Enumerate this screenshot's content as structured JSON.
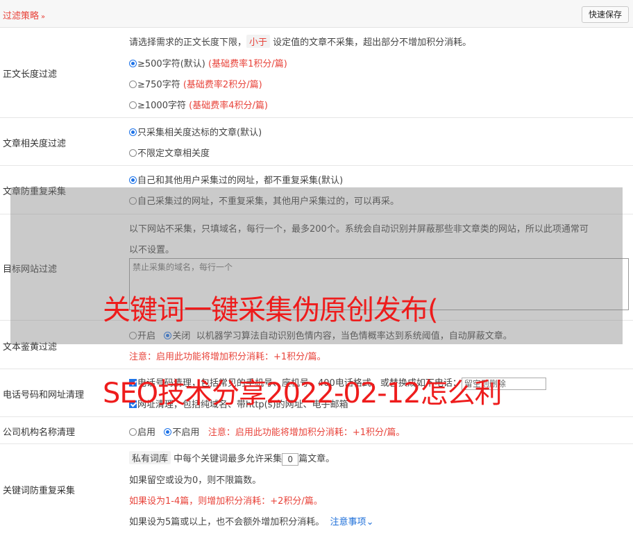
{
  "header": {
    "filter_title": "过滤策略",
    "chevron": "»",
    "save_button": "快速保存"
  },
  "length_filter": {
    "label": "正文长度过滤",
    "intro_pre": "请选择需求的正文长度下限，",
    "intro_tag": "小于",
    "intro_post": " 设定值的文章不采集，超出部分不增加积分消耗。",
    "options": [
      {
        "text": "≥500字符(默认)",
        "rate": "(基础费率1积分/篇)",
        "checked": true
      },
      {
        "text": "≥750字符",
        "rate": "(基础费率2积分/篇)",
        "checked": false
      },
      {
        "text": "≥1000字符",
        "rate": "(基础费率4积分/篇)",
        "checked": false
      }
    ]
  },
  "relevance_filter": {
    "label": "文章相关度过滤",
    "options": [
      {
        "text": "只采集相关度达标的文章(默认)",
        "checked": true
      },
      {
        "text": "不限定文章相关度",
        "checked": false
      }
    ]
  },
  "dedup": {
    "label": "文章防重复采集",
    "options": [
      {
        "text": "自己和其他用户采集过的网址，都不重复采集(默认)",
        "checked": true
      },
      {
        "text": "自己采集过的网址，不重复采集，其他用户采集过的，可以再采。",
        "checked": false
      }
    ]
  },
  "site_filter": {
    "label": "目标网站过滤",
    "desc_line1": "以下网站不采集，只填域名，每行一个，最多200个。系统会自动识别并屏蔽那些非文章类的网站，所以此项通常可",
    "desc_line2": "以不设置。",
    "placeholder": "禁止采集的域名，每行一个"
  },
  "porn_filter": {
    "label": "文本鉴黄过滤",
    "on_label": "开启",
    "off_label": "关闭",
    "desc": "以机器学习算法自动识别色情内容，当色情概率达到系统阈值，自动屏蔽文章。",
    "note": "注意：启用此功能将增加积分消耗：+1积分/篇。"
  },
  "phone_clean": {
    "label": "电话号码和网址清理",
    "phone_text": "电话号码清理，包括常见的手机号、座机号、400电话格式，或替换成如下电话：",
    "phone_placeholder": "留空则删除",
    "url_text": "网址清理，包括纯域名、带http(s)的网址、电子邮箱"
  },
  "org_clean": {
    "label": "公司机构名称清理",
    "on_label": "启用",
    "off_label": "不启用",
    "note": "注意：启用此功能将增加积分消耗：+1积分/篇。"
  },
  "keyword_dedup": {
    "label": "关键词防重复采集",
    "tag": "私有词库",
    "line1_mid": " 中每个关键词最多允许采集",
    "value": "0",
    "line1_post": "篇文章。",
    "line2": "如果留空或设为0，则不限篇数。",
    "line3": "如果设为1-4篇，则增加积分消耗：+2积分/篇。",
    "line4": "如果设为5篇或以上，也不会额外增加积分消耗。",
    "notes_link": "注意事项"
  },
  "watermark": {
    "line1": "关键词一键采集伪原创发布(",
    "line2": "SEO技术分享2022-02-12怎么利"
  }
}
